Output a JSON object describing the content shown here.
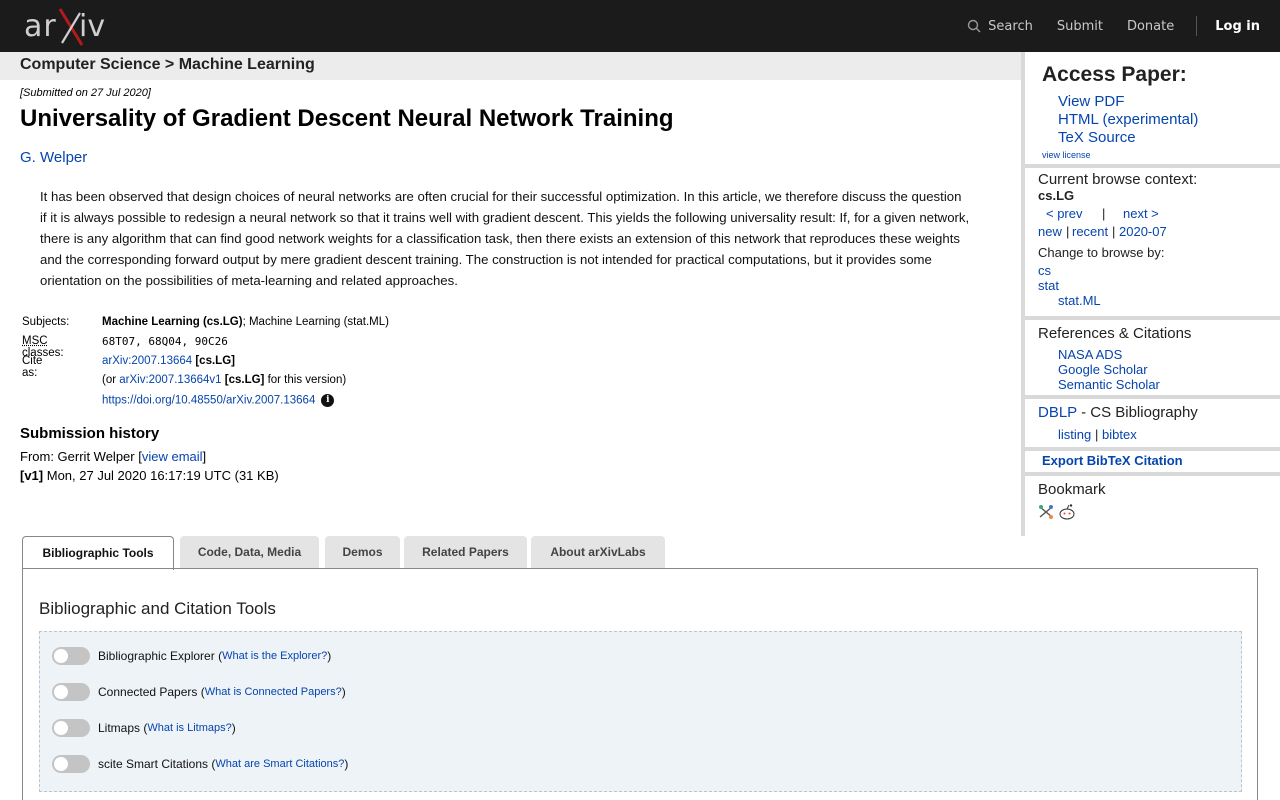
{
  "header": {
    "logo_text": "arXiv",
    "nav": {
      "search": "Search",
      "submit": "Submit",
      "donate": "Donate",
      "login": "Log in"
    }
  },
  "breadcrumb": "Computer Science > Machine Learning",
  "paper": {
    "dateline": "[Submitted on 27 Jul 2020]",
    "title": "Universality of Gradient Descent Neural Network Training",
    "authors": "G. Welper",
    "abstract": "It has been observed that design choices of neural networks are often crucial for their successful optimization. In this article, we therefore discuss the question if it is always possible to redesign a neural network so that it trains well with gradient descent. This yields the following universality result: If, for a given network, there is any algorithm that can find good network weights for a classification task, then there exists an extension of this network that reproduces these weights and the corresponding forward output by mere gradient descent training. The construction is not intended for practical computations, but it provides some orientation on the possibilities of meta-learning and related approaches."
  },
  "meta": {
    "subjects_label": "Subjects:",
    "subjects_primary": "Machine Learning (cs.LG)",
    "subjects_rest": "; Machine Learning (stat.ML)",
    "msc_abbr": "MSC",
    "msc_label_rest": " classes:",
    "msc_value": "68T07, 68Q04, 90C26",
    "cite_label": "Cite as:",
    "cite_id": "arXiv:2007.13664",
    "cite_cat": " [cs.LG]",
    "cite_or_pre": "(or ",
    "cite_version_id": "arXiv:2007.13664v1",
    "cite_version_cat": " [cs.LG]",
    "cite_version_post": " for this version)",
    "doi": "https://doi.org/10.48550/arXiv.2007.13664",
    "info_glyph": "i"
  },
  "history": {
    "title": "Submission history",
    "from_text": "From: Gerrit Welper [",
    "view_email": "view email",
    "from_close": "]",
    "v1_tag": "[v1]",
    "v1_text": " Mon, 27 Jul 2020 16:17:19 UTC (31 KB)"
  },
  "sidebar": {
    "access_title": "Access Paper:",
    "view_pdf": "View PDF",
    "html": "HTML (experimental)",
    "tex": "TeX Source",
    "license": "view license",
    "context_title": "Current browse context:",
    "context_value": "cs.LG",
    "prev": "< prev",
    "pipe": "|",
    "next": "next >",
    "new": "new",
    "recent": "recent",
    "month": "2020-07",
    "change_by": "Change to browse by:",
    "browse_cs": "cs",
    "browse_stat": "stat",
    "browse_statml": "stat.ML",
    "refs_title": "References & Citations",
    "nasa": "NASA ADS",
    "google": "Google Scholar",
    "semantic": "Semantic Scholar",
    "dblp": "DBLP",
    "dblp_rest": " - CS Bibliography",
    "listing": "listing",
    "bibtex": "bibtex",
    "export": "Export BibTeX Citation",
    "bookmark": "Bookmark"
  },
  "tabs": [
    "Bibliographic Tools",
    "Code, Data, Media",
    "Demos",
    "Related Papers",
    "About arXivLabs"
  ],
  "tools": {
    "panel_title": "Bibliographic and Citation Tools",
    "items": [
      {
        "label": "Bibliographic Explorer",
        "help": "What is the Explorer?"
      },
      {
        "label": "Connected Papers",
        "help": "What is Connected Papers?"
      },
      {
        "label": "Litmaps",
        "help": "What is Litmaps?"
      },
      {
        "label": "scite Smart Citations",
        "help": "What are Smart Citations?"
      }
    ]
  },
  "colors": {
    "topbar": "#1b1b1b",
    "link": "#0645ad",
    "logo_x": "#b31b1b"
  }
}
